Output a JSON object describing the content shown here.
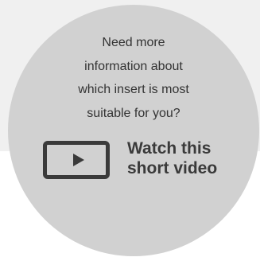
{
  "promo": {
    "question_text": "Need more\ninformation about\nwhich insert is most\nsuitable for you?",
    "video_cta": {
      "label": "Watch this\nshort video",
      "icon": "play-video-icon"
    }
  },
  "colors": {
    "background_band": "#f0f0f0",
    "circle_fill": "#d1d1d1",
    "text": "#333333",
    "cta_text": "#3a3a3a"
  }
}
